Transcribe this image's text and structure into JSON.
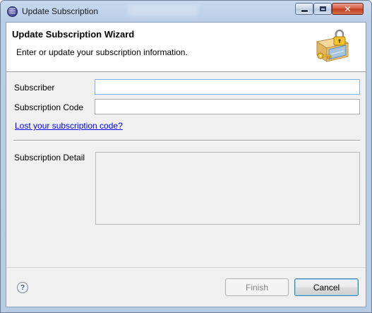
{
  "window": {
    "title": "Update Subscription"
  },
  "header": {
    "title": "Update Subscription Wizard",
    "description": "Enter or update your subscription information."
  },
  "form": {
    "subscriber_label": "Subscriber",
    "subscriber_value": "",
    "code_label": "Subscription Code",
    "code_value": "",
    "lost_link": "Lost your subscription code?",
    "detail_label": "Subscription Detail"
  },
  "footer": {
    "help_glyph": "?",
    "finish_label": "Finish",
    "cancel_label": "Cancel"
  },
  "icons": {
    "app": "eclipse-icon",
    "banner": "box-lock-key-icon",
    "help": "help-icon"
  },
  "colors": {
    "link": "#0000ff",
    "focus_border": "#7eb4ea",
    "close_button": "#c23a20"
  }
}
